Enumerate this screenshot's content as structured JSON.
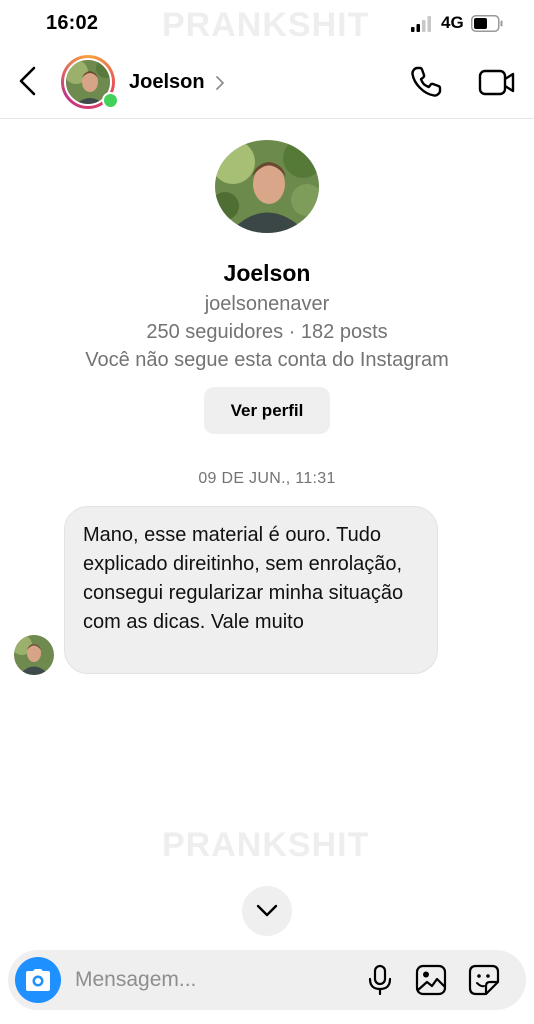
{
  "status_bar": {
    "time": "16:02",
    "network": "4G",
    "watermark": "PRANKSHIT"
  },
  "header": {
    "name": "Joelson",
    "online": true
  },
  "profile": {
    "name": "Joelson",
    "username": "joelsonenaver",
    "stats": "250 seguidores · 182 posts",
    "note": "Você não segue esta conta do Instagram",
    "view_button": "Ver perfil"
  },
  "thread": {
    "timestamp": "09 DE JUN., 11:31",
    "messages": [
      {
        "sender": "Joelson",
        "text": "Mano, esse material é ouro. Tudo explicado direitinho, sem enrolação, consegui regularizar minha situação com as dicas. Vale muito"
      }
    ]
  },
  "composer": {
    "placeholder": "Mensagem..."
  },
  "footer_watermark": "PRANKSHIT",
  "colors": {
    "accent": "#1e90ff",
    "online": "#43d15a",
    "bubble": "#efefef",
    "secondary_text": "#737373"
  }
}
